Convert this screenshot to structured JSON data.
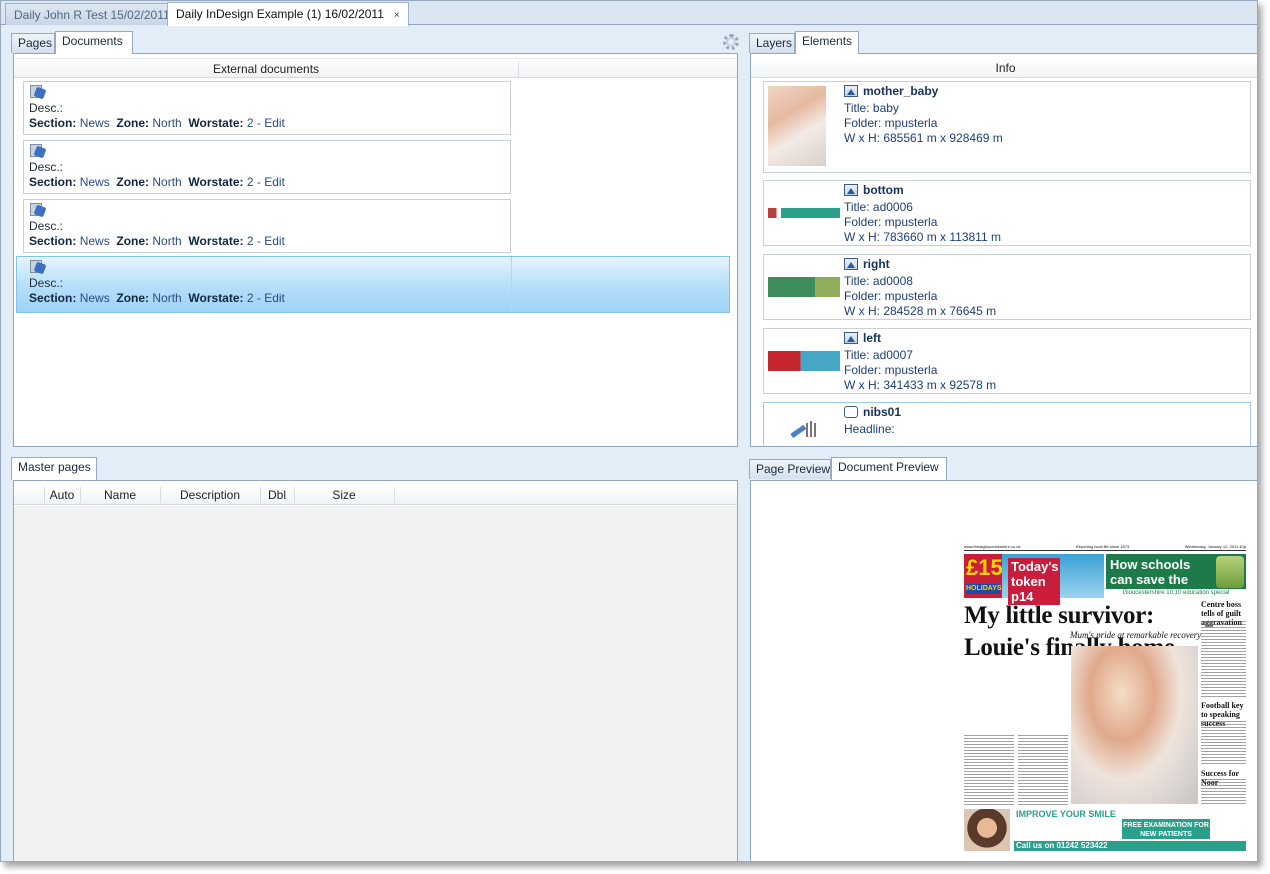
{
  "doc_tabs": [
    {
      "label": "Daily John R Test 15/02/2011"
    },
    {
      "label": "Daily InDesign Example (1) 16/02/2011",
      "close": "×"
    }
  ],
  "left_top": {
    "tabs": [
      "Pages",
      "Documents"
    ],
    "active_tab": "Documents",
    "column_header": "External documents",
    "rows": [
      {
        "desc": "Desc.:",
        "section_label": "Section:",
        "section": "News",
        "zone_label": "Zone:",
        "zone": "North",
        "worstate_label": "Worstate:",
        "worstate": "2 - Edit"
      },
      {
        "desc": "Desc.:",
        "section_label": "Section:",
        "section": "News",
        "zone_label": "Zone:",
        "zone": "North",
        "worstate_label": "Worstate:",
        "worstate": "2 - Edit"
      },
      {
        "desc": "Desc.:",
        "section_label": "Section:",
        "section": "News",
        "zone_label": "Zone:",
        "zone": "North",
        "worstate_label": "Worstate:",
        "worstate": "2 - Edit"
      },
      {
        "desc": "Desc.:",
        "section_label": "Section:",
        "section": "News",
        "zone_label": "Zone:",
        "zone": "North",
        "worstate_label": "Worstate:",
        "worstate": "2 - Edit",
        "selected": true
      }
    ]
  },
  "right_top": {
    "tabs": [
      "Layers",
      "Elements"
    ],
    "active_tab": "Elements",
    "column_header": "Info",
    "elements": [
      {
        "name": "mother_baby",
        "title": "Title: baby",
        "folder": "Folder: mpusterla",
        "size": "W x H: 685561 m x 928469 m",
        "icon": "image-icon"
      },
      {
        "name": "bottom",
        "title": "Title: ad0006",
        "folder": "Folder: mpusterla",
        "size": "W x H: 783660 m x 113811 m",
        "icon": "image-icon"
      },
      {
        "name": "right",
        "title": "Title: ad0008",
        "folder": "Folder: mpusterla",
        "size": "W x H: 284528 m x 76645 m",
        "icon": "image-icon"
      },
      {
        "name": "left",
        "title": "Title: ad0007",
        "folder": "Folder: mpusterla",
        "size": "W x H: 341433 m x 92578 m",
        "icon": "image-icon"
      },
      {
        "name": "nibs01",
        "headline": "Headline:",
        "icon": "text-tool-icon"
      }
    ]
  },
  "left_bottom": {
    "tabs": [
      "Master pages"
    ],
    "columns": [
      "Auto",
      "Name",
      "Description",
      "Dbl",
      "Size"
    ]
  },
  "right_bottom": {
    "tabs": [
      "Page Preview",
      "Document Preview"
    ],
    "active_tab": "Document Preview",
    "newspaper": {
      "topline_left": "www.thisisgloucestershire.co.uk",
      "topline_mid": "Reporting local life since 1873",
      "topline_right": "Wednesday, January 12, 2011  40p",
      "ad_price": "£15",
      "ad_holidays": "HOLIDAYS",
      "ad_token": "Today's token p14",
      "ad2_text": "How schools can save the planet",
      "ad2_strip": "Gloucestershire 10:10 education special",
      "headline": "My little survivor: Louie's finally home",
      "subhead": "Mum's pride at remarkable recovery",
      "right_head1": "Centre boss tells of guilt aggravation",
      "right_head2": "Football key to speaking success",
      "right_head3": "Success for Noor",
      "ad_bottom_title": "IMPROVE YOUR SMILE",
      "ad_bottom_exam": "FREE EXAMINATION FOR NEW PATIENTS",
      "ad_bottom_call": "Call us on 01242 523422"
    }
  },
  "colors": {
    "frame": "#e2edf7",
    "selection": "#b4defa",
    "link_text": "#2a4c82"
  }
}
